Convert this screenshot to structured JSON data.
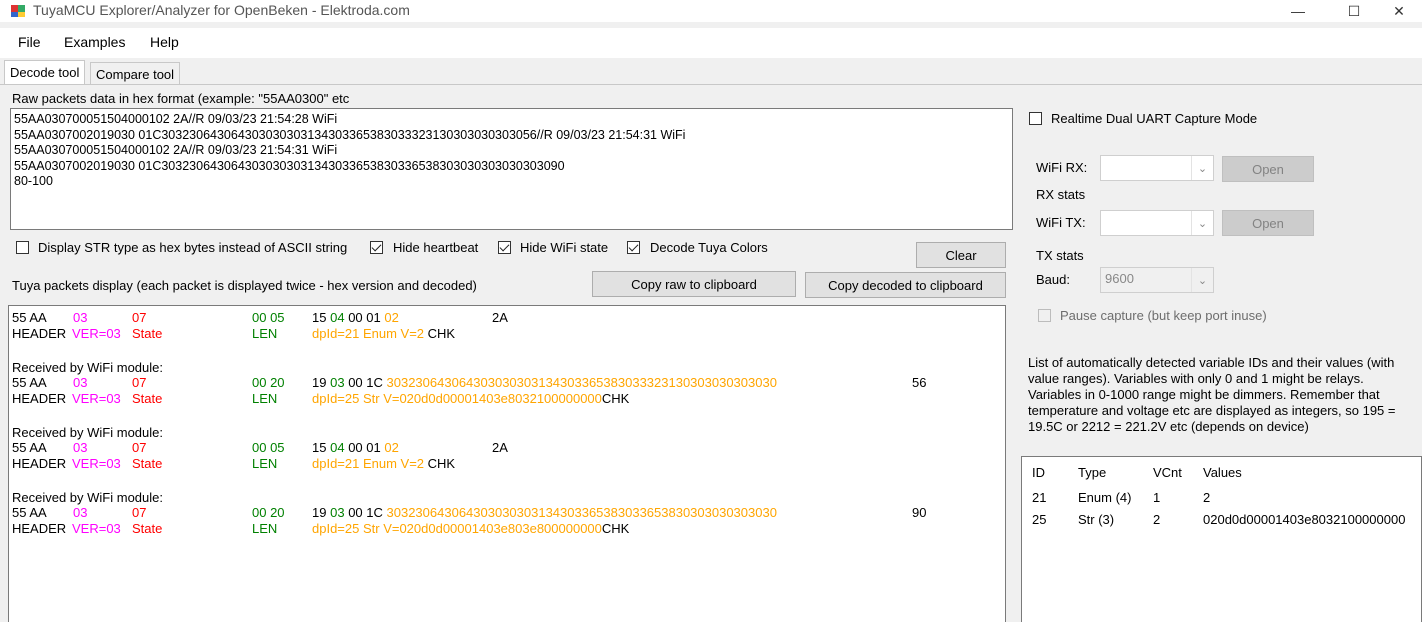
{
  "window": {
    "title": "TuyaMCU Explorer/Analyzer for OpenBeken - Elektroda.com",
    "controls": [
      "—",
      "☐",
      "✕"
    ]
  },
  "menu": {
    "items": [
      "File",
      "Examples",
      "Help"
    ]
  },
  "tabs": [
    {
      "label": "Decode tool",
      "active": true
    },
    {
      "label": "Compare tool",
      "active": false
    }
  ],
  "raw": {
    "label": "Raw packets data in hex format (example: \"55AA0300\" etc",
    "lines": [
      "55AA030700051504000102 2A//R 09/03/23 21:54:28 WiFi",
      "55AA0307002019030 01C303230643064303030303134303365383033323130303030303056//R 09/03/23 21:54:31 WiFi",
      "55AA030700051504000102 2A//R 09/03/23 21:54:31 WiFi",
      "55AA0307002019030 01C3032306430643030303031343033653830336538303030303030303090",
      "80-100"
    ]
  },
  "options": {
    "display_str_hex": {
      "label": "Display STR type as hex bytes instead of ASCII string",
      "checked": false
    },
    "hide_heartbeat": {
      "label": "Hide heartbeat",
      "checked": true
    },
    "hide_wifi_state": {
      "label": "Hide WiFi state",
      "checked": true
    },
    "decode_tuya_colors": {
      "label": "Decode Tuya Colors",
      "checked": true
    }
  },
  "buttons": {
    "clear": "Clear",
    "copy_raw": "Copy raw to clipboard",
    "copy_decoded": "Copy decoded to clipboard"
  },
  "packets": {
    "label": "Tuya packets display (each packet is displayed twice - hex version and decoded)",
    "received_label": "Received by WiFi module:",
    "header_hex": "55 AA",
    "header_label": "HEADER",
    "ver_hex": "03",
    "ver_label": "VER=03",
    "cmd_hex": "07",
    "cmd_label": "State",
    "len_label": "LEN",
    "chk_label": "CHK",
    "items": [
      {
        "len_hex": "00 05",
        "dp_pre": "15",
        "dp_type": "04",
        "dp_mid": "00 01",
        "dp_data": "02",
        "dp_desc": "dpId=21 Enum V=2 ",
        "chk": "2A",
        "received": false
      },
      {
        "len_hex": "00 20",
        "dp_pre": "19",
        "dp_type": "03",
        "dp_mid": "00 1C",
        "dp_data": "303230643064303030303134303365383033323130303030303030",
        "dp_desc": "dpId=25 Str V=020d0d00001403e8032100000000",
        "chk": "56",
        "received": true
      },
      {
        "len_hex": "00 05",
        "dp_pre": "15",
        "dp_type": "04",
        "dp_mid": "00 01",
        "dp_data": "02",
        "dp_desc": "dpId=21 Enum V=2 ",
        "chk": "2A",
        "received": true
      },
      {
        "len_hex": "00 20",
        "dp_pre": "19",
        "dp_type": "03",
        "dp_mid": "00 1C",
        "dp_data": "303230643064303030303134303365383033653830303030303030",
        "dp_desc": "dpId=25 Str V=020d0d00001403e803e800000000",
        "chk": "90",
        "received": true
      }
    ]
  },
  "uart": {
    "realtime_label": "Realtime Dual UART Capture Mode",
    "realtime_checked": false,
    "wifi_rx_label": "WiFi RX:",
    "rx_stats_label": "RX stats",
    "wifi_tx_label": "WiFi TX:",
    "tx_stats_label": "TX stats",
    "baud_label": "Baud:",
    "baud_value": "9600",
    "open_label": "Open",
    "pause_label": "Pause capture (but keep port inuse)"
  },
  "variables": {
    "description": "List of automatically detected variable IDs  and their values (with value ranges). Variables with only 0 and 1 might be relays. Variables in 0-1000 range might be dimmers. Remember that temperature and voltage etc are displayed as integers, so 195 = 19.5C or 2212 = 221.2V etc (depends on device)",
    "columns": [
      "ID",
      "Type",
      "VCnt",
      "Values"
    ],
    "rows": [
      {
        "id": "21",
        "type": "Enum (4)",
        "vcnt": "1",
        "values": "2"
      },
      {
        "id": "25",
        "type": "Str (3)",
        "vcnt": "2",
        "values": "020d0d00001403e8032100000000"
      }
    ]
  },
  "colors": {
    "ver": "#ff00ff",
    "cmd": "#ff0000",
    "len": "#008000",
    "data": "#ffa500"
  }
}
